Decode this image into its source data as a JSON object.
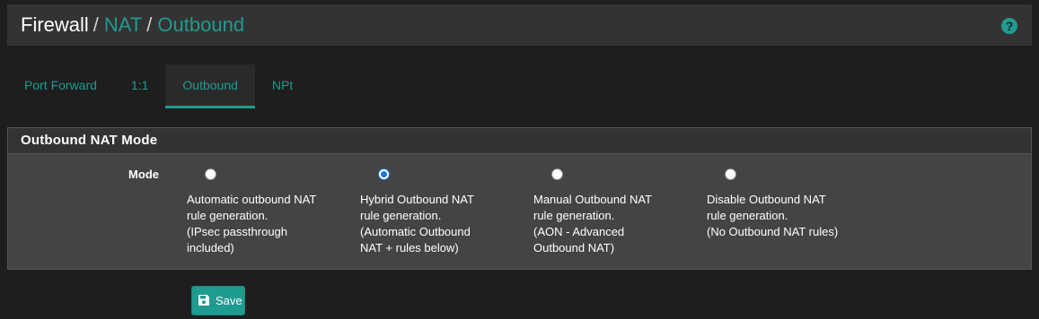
{
  "header": {
    "crumb_home": "Firewall",
    "separator": "/",
    "crumb_nat": "NAT",
    "crumb_current": "Outbound",
    "help_icon": "help-icon"
  },
  "tabs": [
    {
      "label": "Port Forward",
      "active": false
    },
    {
      "label": "1:1",
      "active": false
    },
    {
      "label": "Outbound",
      "active": true
    },
    {
      "label": "NPt",
      "active": false
    }
  ],
  "panel": {
    "title": "Outbound NAT Mode",
    "mode_label": "Mode",
    "options": [
      {
        "lines": [
          "Automatic outbound NAT",
          "rule generation.",
          "(IPsec passthrough",
          "included)"
        ],
        "checked": false
      },
      {
        "lines": [
          "Hybrid Outbound NAT",
          "rule generation.",
          "(Automatic Outbound",
          "NAT + rules below)"
        ],
        "checked": true
      },
      {
        "lines": [
          "Manual Outbound NAT",
          "rule generation.",
          "(AON - Advanced",
          "Outbound NAT)"
        ],
        "checked": false
      },
      {
        "lines": [
          "Disable Outbound NAT",
          "rule generation.",
          "(No Outbound NAT rules)"
        ],
        "checked": false
      }
    ]
  },
  "save_button": {
    "label": "Save",
    "icon": "floppy-disk-icon"
  },
  "colors": {
    "accent": "#1f9b8f",
    "background": "#1e1e1e",
    "panel": "#444444"
  }
}
